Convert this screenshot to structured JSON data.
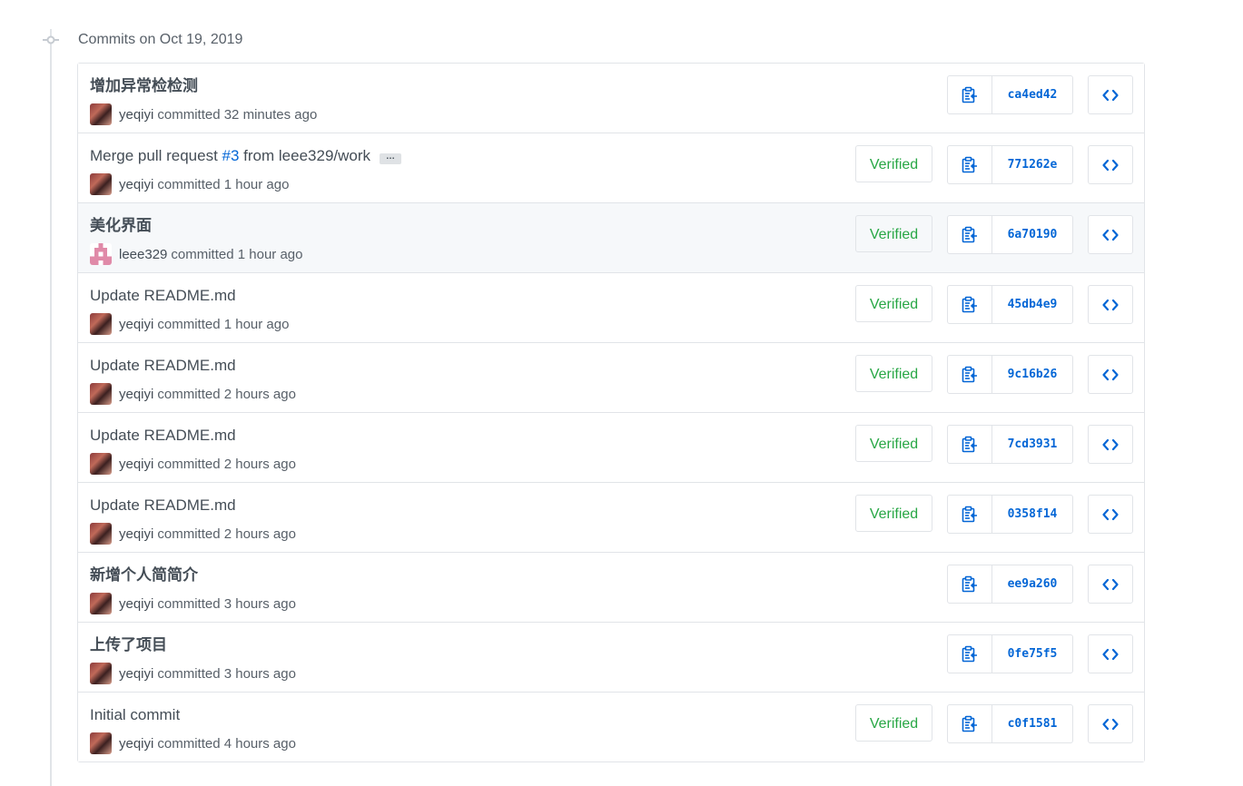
{
  "group": {
    "title": "Commits on Oct 19, 2019"
  },
  "colors": {
    "link": "#0366d6",
    "verified": "#28a745",
    "border": "#e1e4e8"
  },
  "labels": {
    "verified": "Verified",
    "committed": "committed",
    "ellipsis": "…"
  },
  "commits": [
    {
      "message": "增加异常检检测",
      "author": "yeqiyi",
      "time": "32 minutes ago",
      "verified": false,
      "sha": "ca4ed42",
      "avatar": "photo"
    },
    {
      "message_prefix": "Merge pull request ",
      "issue_ref": "#3",
      "message_suffix": " from leee329/work",
      "author": "yeqiyi",
      "time": "1 hour ago",
      "verified": true,
      "sha": "771262e",
      "avatar": "photo",
      "has_ellipsis": true
    },
    {
      "message": "美化界面",
      "author": "leee329",
      "time": "1 hour ago",
      "verified": true,
      "sha": "6a70190",
      "avatar": "identicon",
      "highlighted": true
    },
    {
      "message": "Update README.md",
      "author": "yeqiyi",
      "time": "1 hour ago",
      "verified": true,
      "sha": "45db4e9",
      "avatar": "photo"
    },
    {
      "message": "Update README.md",
      "author": "yeqiyi",
      "time": "2 hours ago",
      "verified": true,
      "sha": "9c16b26",
      "avatar": "photo"
    },
    {
      "message": "Update README.md",
      "author": "yeqiyi",
      "time": "2 hours ago",
      "verified": true,
      "sha": "7cd3931",
      "avatar": "photo"
    },
    {
      "message": "Update README.md",
      "author": "yeqiyi",
      "time": "2 hours ago",
      "verified": true,
      "sha": "0358f14",
      "avatar": "photo"
    },
    {
      "message": "新增个人简简介",
      "author": "yeqiyi",
      "time": "3 hours ago",
      "verified": false,
      "sha": "ee9a260",
      "avatar": "photo"
    },
    {
      "message": "上传了项目",
      "author": "yeqiyi",
      "time": "3 hours ago",
      "verified": false,
      "sha": "0fe75f5",
      "avatar": "photo"
    },
    {
      "message": "Initial commit",
      "author": "yeqiyi",
      "time": "4 hours ago",
      "verified": true,
      "sha": "c0f1581",
      "avatar": "photo"
    }
  ]
}
